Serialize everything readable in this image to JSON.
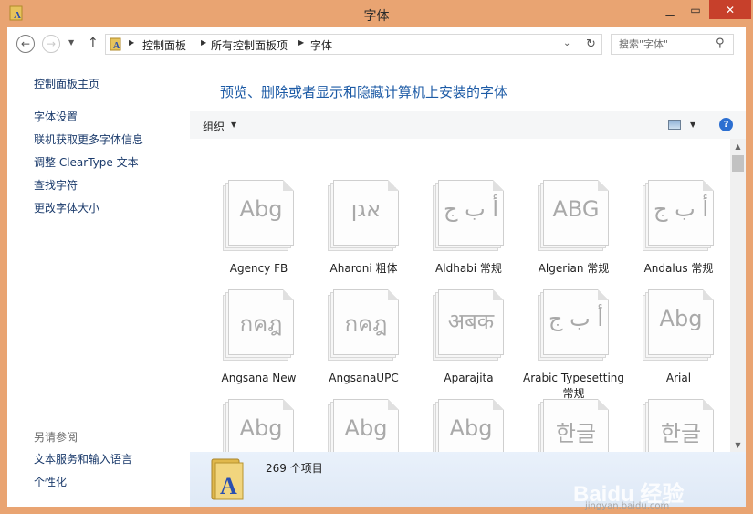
{
  "window": {
    "title": "字体",
    "minimize_icon": "minimize-icon",
    "maximize_icon": "maximize-icon",
    "close_icon": "close-icon"
  },
  "navigation": {
    "back_icon": "back-arrow-icon",
    "forward_icon": "forward-arrow-icon",
    "recent_icon": "chevron-down-icon",
    "up_icon": "up-arrow-icon",
    "breadcrumb": [
      "控制面板",
      "所有控制面板项",
      "字体"
    ],
    "refresh_icon": "refresh-icon"
  },
  "search": {
    "placeholder": "搜索\"字体\""
  },
  "sidebar": {
    "home": "控制面板主页",
    "links": [
      "字体设置",
      "联机获取更多字体信息",
      "调整 ClearType 文本",
      "查找字符",
      "更改字体大小"
    ],
    "see_also_title": "另请参阅",
    "see_also": [
      "文本服务和输入语言",
      "个性化"
    ]
  },
  "main": {
    "title": "预览、删除或者显示和隐藏计算机上安装的字体",
    "toolbar": {
      "organize": "组织",
      "view_icon": "view-icon",
      "help": "?"
    },
    "fonts": [
      {
        "name": "Agency FB",
        "sample": "Abg"
      },
      {
        "name": "Aharoni 粗体",
        "sample": "אגן"
      },
      {
        "name": "Aldhabi 常规",
        "sample": "أ ب ج"
      },
      {
        "name": "Algerian 常规",
        "sample": "ABG"
      },
      {
        "name": "Andalus 常规",
        "sample": "أ ب ج"
      },
      {
        "name": "Angsana New",
        "sample": "กคฎ"
      },
      {
        "name": "AngsanaUPC",
        "sample": "กคฎ"
      },
      {
        "name": "Aparajita",
        "sample": "अबक"
      },
      {
        "name": "Arabic Typesetting 常规",
        "sample": "أ ب ج"
      },
      {
        "name": "Arial",
        "sample": "Abg"
      },
      {
        "name": "",
        "sample": "Abg"
      },
      {
        "name": "",
        "sample": "Abg"
      },
      {
        "name": "",
        "sample": "Abg"
      },
      {
        "name": "",
        "sample": "한글"
      },
      {
        "name": "",
        "sample": "한글"
      }
    ]
  },
  "status": {
    "count": "269 个项目"
  },
  "watermark": {
    "text": "Baidu 经验",
    "url": "jingyan.baidu.com"
  }
}
